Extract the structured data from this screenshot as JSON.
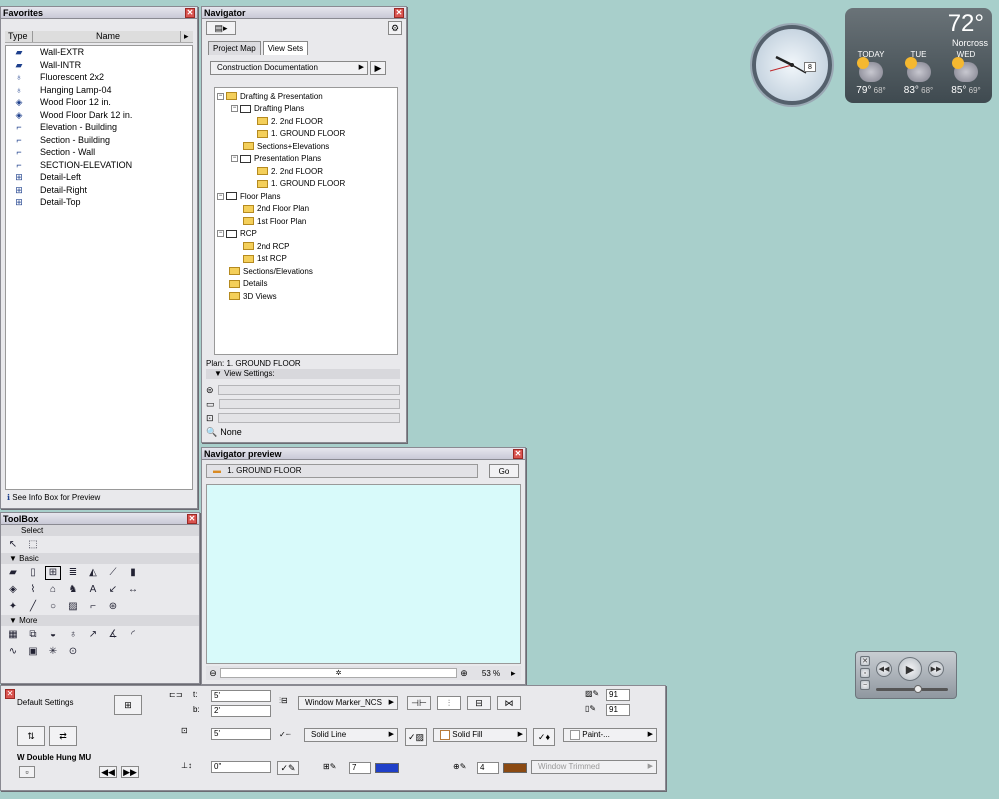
{
  "favorites": {
    "title": "Favorites",
    "col_type": "Type",
    "col_name": "Name",
    "items": [
      {
        "label": "Wall-EXTR",
        "icon": "wall-icon"
      },
      {
        "label": "Wall-INTR",
        "icon": "wall-icon"
      },
      {
        "label": "Fluorescent 2x2",
        "icon": "lamp-icon"
      },
      {
        "label": "Hanging Lamp-04",
        "icon": "lamp-icon"
      },
      {
        "label": "Wood Floor 12 in.",
        "icon": "slab-icon"
      },
      {
        "label": "Wood Floor Dark 12 in.",
        "icon": "slab-icon"
      },
      {
        "label": "Elevation - Building",
        "icon": "section-icon"
      },
      {
        "label": "Section - Building",
        "icon": "section-icon"
      },
      {
        "label": "Section - Wall",
        "icon": "section-icon"
      },
      {
        "label": "SECTION-ELEVATION",
        "icon": "section-icon"
      },
      {
        "label": "Detail-Left",
        "icon": "detail-icon"
      },
      {
        "label": "Detail-Right",
        "icon": "detail-icon"
      },
      {
        "label": "Detail-Top",
        "icon": "detail-icon"
      }
    ],
    "footer": "See Info Box for Preview"
  },
  "navigator": {
    "title": "Navigator",
    "tabs": [
      "Project Map",
      "View Sets"
    ],
    "view_set": "Construction Documentation",
    "tree": [
      {
        "label": "Drafting & Presentation",
        "level": 0
      },
      {
        "label": "Drafting Plans",
        "level": 1
      },
      {
        "label": "2. 2nd FLOOR",
        "level": 2
      },
      {
        "label": "1. GROUND FLOOR",
        "level": 2
      },
      {
        "label": "Sections+Elevations",
        "level": 1
      },
      {
        "label": "Presentation Plans",
        "level": 1
      },
      {
        "label": "2. 2nd FLOOR",
        "level": 2
      },
      {
        "label": "1. GROUND FLOOR",
        "level": 2
      },
      {
        "label": "Floor Plans",
        "level": 0
      },
      {
        "label": "2nd Floor Plan",
        "level": 1
      },
      {
        "label": "1st Floor Plan",
        "level": 1
      },
      {
        "label": "RCP",
        "level": 0
      },
      {
        "label": "2nd RCP",
        "level": 1
      },
      {
        "label": "1st RCP",
        "level": 1
      },
      {
        "label": "Sections/Elevations",
        "level": 0
      },
      {
        "label": "Details",
        "level": 0
      },
      {
        "label": "3D Views",
        "level": 0
      }
    ],
    "plan_label": "Plan: 1. GROUND FLOOR",
    "view_settings": "View Settings:",
    "none_label": "None"
  },
  "preview": {
    "title": "Navigator preview",
    "current": "1. GROUND FLOOR",
    "go": "Go",
    "zoom": "53 %"
  },
  "toolbox": {
    "title": "ToolBox",
    "select": "Select",
    "basic": "Basic",
    "more": "More"
  },
  "infobox": {
    "default_settings": "Default Settings",
    "t_label": "t:",
    "b_label": "b:",
    "t_val": "5'",
    "b_val": "2'",
    "marker": "Window Marker_NCS",
    "w_val": "5'",
    "line": "Solid Line",
    "fill": "Solid Fill",
    "paint": "Paint-...",
    "elev": "0\"",
    "pen1": "7",
    "pen2": "4",
    "n1": "91",
    "n2": "91",
    "name": "W Double Hung MU",
    "window_trimmed": "Window Trimmed"
  },
  "weather": {
    "temp": "72°",
    "location": "Norcross",
    "days": [
      {
        "name": "TODAY",
        "hi": "79°",
        "lo": "68°"
      },
      {
        "name": "TUE",
        "hi": "83°",
        "lo": "68°"
      },
      {
        "name": "WED",
        "hi": "85°",
        "lo": "69°"
      }
    ]
  },
  "clock": {
    "date": "8"
  }
}
